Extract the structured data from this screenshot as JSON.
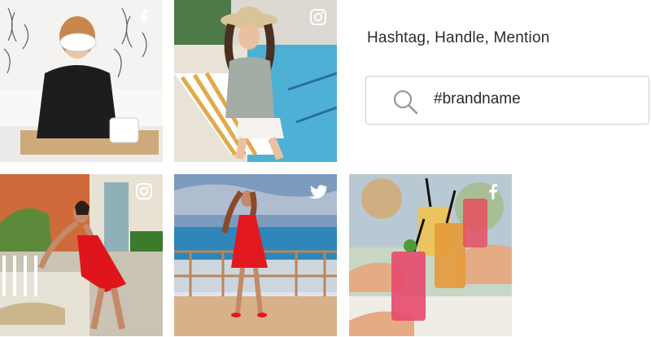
{
  "panel": {
    "heading": "Hashtag, Handle, Mention"
  },
  "search": {
    "value": "#brandname",
    "icon": "search-icon"
  },
  "tiles": [
    {
      "platform": "facebook",
      "icon": "facebook-icon"
    },
    {
      "platform": "instagram",
      "icon": "instagram-icon"
    },
    {
      "platform": "instagram",
      "icon": "instagram-icon"
    },
    {
      "platform": "twitter",
      "icon": "twitter-icon"
    },
    {
      "platform": "facebook",
      "icon": "facebook-icon"
    }
  ],
  "colors": {
    "text": "#2b2b2b",
    "border": "#cfcfcf",
    "icon_gray": "#9a9a9a"
  }
}
